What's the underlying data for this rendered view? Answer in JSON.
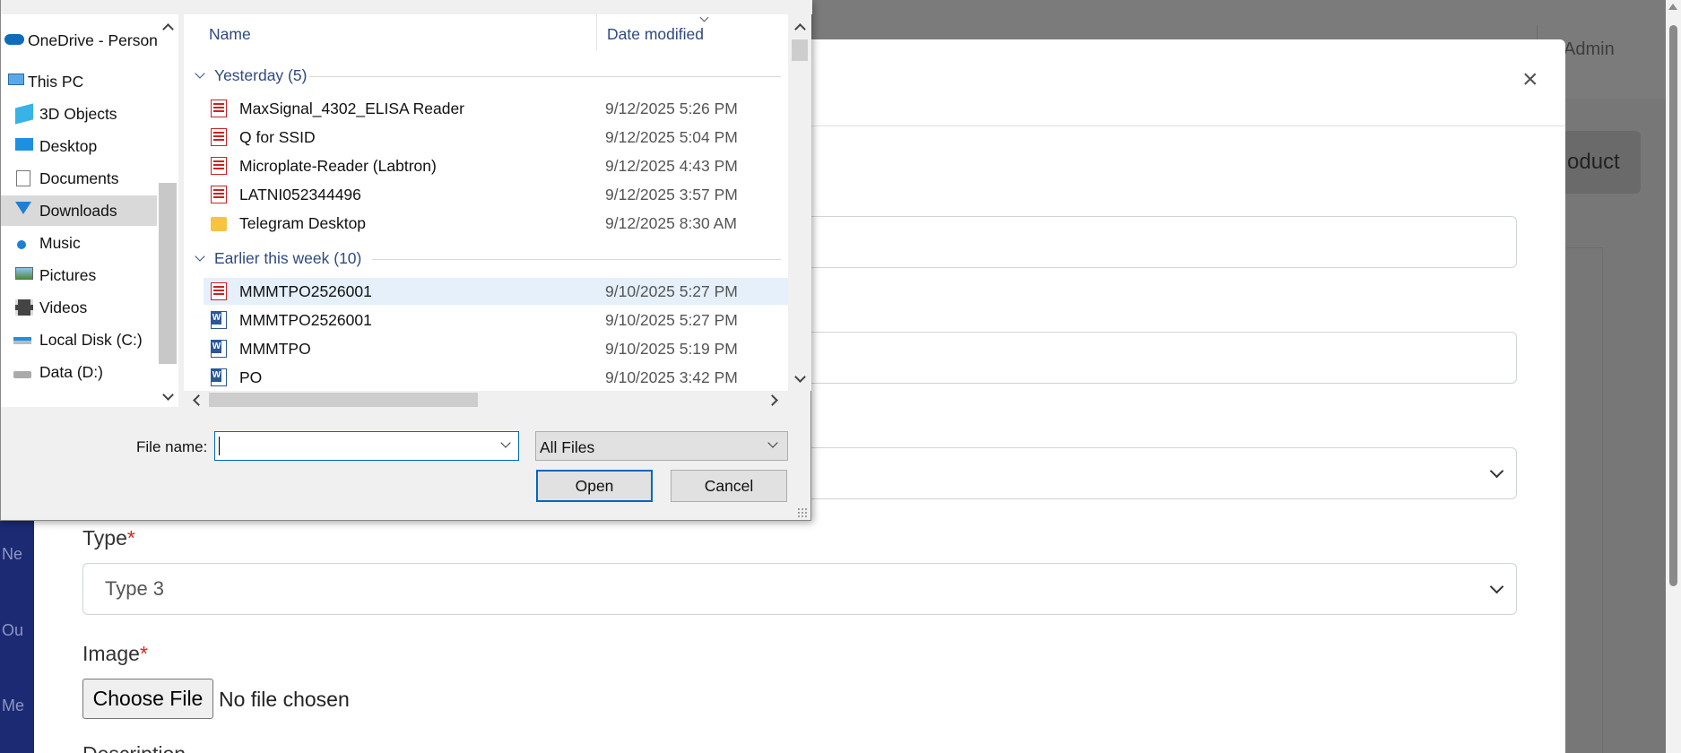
{
  "background": {
    "admin_label": "Admin",
    "primary_button_peek": "oduct",
    "sidebar_peeks": [
      "Ne",
      "Ou",
      "Me"
    ],
    "modal": {
      "close_glyph": "×",
      "type_label": "Type",
      "type_value": "Type 3",
      "image_label": "Image",
      "required_mark": "*",
      "choose_file_label": "Choose File",
      "no_file_text": "No file chosen",
      "description_label": "Description"
    }
  },
  "dialog": {
    "nav_items": [
      {
        "label": "OneDrive - Person",
        "icon": "cloud-icon"
      },
      {
        "label": "This PC",
        "icon": "computer-icon"
      },
      {
        "label": "3D Objects",
        "icon": "cube-icon"
      },
      {
        "label": "Desktop",
        "icon": "desktop-icon"
      },
      {
        "label": "Documents",
        "icon": "document-icon"
      },
      {
        "label": "Downloads",
        "icon": "download-arrow-icon",
        "selected": true
      },
      {
        "label": "Music",
        "icon": "music-note-icon"
      },
      {
        "label": "Pictures",
        "icon": "picture-icon"
      },
      {
        "label": "Videos",
        "icon": "film-icon"
      },
      {
        "label": "Local Disk (C:)",
        "icon": "windows-drive-icon"
      },
      {
        "label": "Data (D:)",
        "icon": "drive-icon"
      }
    ],
    "columns": {
      "name": "Name",
      "date": "Date modified"
    },
    "groups": [
      {
        "label": "Yesterday (5)",
        "files": [
          {
            "name": "MaxSignal_4302_ELISA Reader",
            "date": "9/12/2025 5:26 PM",
            "type": "pdf"
          },
          {
            "name": "Q for SSID",
            "date": "9/12/2025 5:04 PM",
            "type": "pdf"
          },
          {
            "name": "Microplate-Reader (Labtron)",
            "date": "9/12/2025 4:43 PM",
            "type": "pdf"
          },
          {
            "name": "LATNI052344496",
            "date": "9/12/2025 3:57 PM",
            "type": "pdf"
          },
          {
            "name": "Telegram Desktop",
            "date": "9/12/2025 8:30 AM",
            "type": "folder"
          }
        ]
      },
      {
        "label": "Earlier this week (10)",
        "files": [
          {
            "name": "MMMTPO2526001",
            "date": "9/10/2025 5:27 PM",
            "type": "pdf",
            "selected": true
          },
          {
            "name": "MMMTPO2526001",
            "date": "9/10/2025 5:27 PM",
            "type": "word"
          },
          {
            "name": "MMMTPO",
            "date": "9/10/2025 5:19 PM",
            "type": "word"
          },
          {
            "name": "PO",
            "date": "9/10/2025 3:42 PM",
            "type": "word"
          }
        ]
      }
    ],
    "file_name_label": "File name:",
    "file_name_value": "",
    "file_type_value": "All Files",
    "open_label": "Open",
    "cancel_label": "Cancel"
  }
}
